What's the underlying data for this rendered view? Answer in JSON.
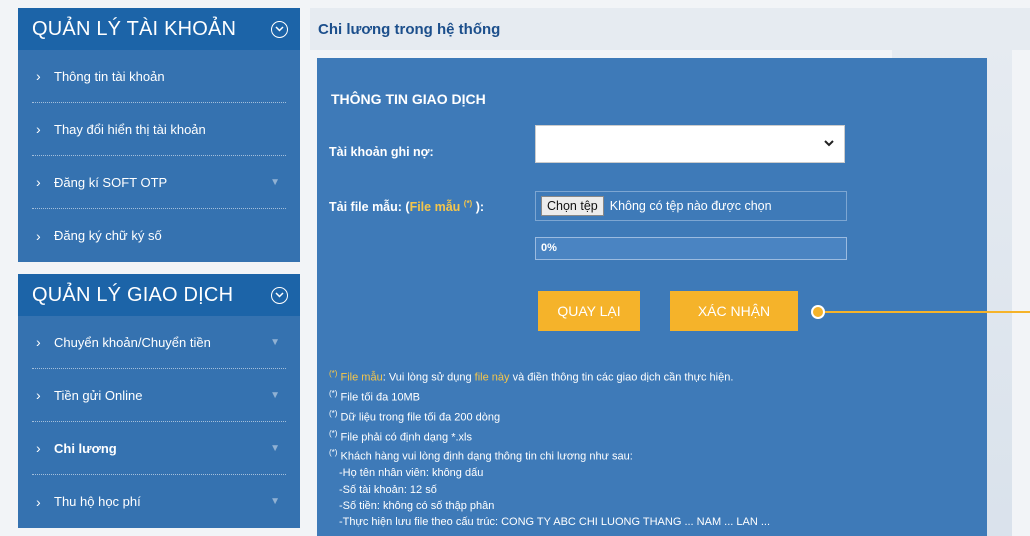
{
  "sidebar": {
    "account_section": {
      "title": "QUẢN LÝ TÀI KHOẢN",
      "items": [
        {
          "label": "Thông tin tài khoản"
        },
        {
          "label": "Thay đổi hiển thị tài khoản"
        },
        {
          "label": "Đăng kí SOFT OTP"
        },
        {
          "label": "Đăng ký chữ ký số"
        }
      ]
    },
    "transaction_section": {
      "title": "QUẢN LÝ GIAO DỊCH",
      "items": [
        {
          "label": "Chuyển khoản/Chuyển tiền"
        },
        {
          "label": "Tiền gửi Online"
        },
        {
          "label": "Chi lương"
        },
        {
          "label": "Thu hộ học phí"
        }
      ]
    }
  },
  "main": {
    "title": "Chi lương trong hệ thống",
    "panel_title": "THÔNG TIN GIAO DỊCH",
    "debit_label": "Tài khoản ghi nợ:",
    "debit_value": "",
    "file_label_prefix": "Tải file mẫu: (",
    "file_label_link": "File mẫu",
    "file_label_mark": "(*)",
    "file_label_suffix": " ):",
    "file_button": "Chọn tệp",
    "file_status": "Không có tệp nào được chọn",
    "progress_text": "0%",
    "progress_value": 0,
    "back_button": "QUAY LẠI",
    "confirm_button": "XÁC NHẬN"
  },
  "notes": {
    "mark": "(*)",
    "line1_link1": "File mẫu",
    "line1_mid": ": Vui lòng sử dụng ",
    "line1_link2": "file này",
    "line1_end": " và điền thông tin các giao dịch cần thực hiện.",
    "line2": " File tối đa 10MB",
    "line3": " Dữ liệu trong file tối đa 200 dòng",
    "line4": " File phải có định dạng *.xls",
    "line5": " Khách hàng vui lòng định dạng thông tin chi lương như sau:",
    "sub1": "-Họ tên nhân viên: không dấu",
    "sub2": "-Số tài khoản: 12 số",
    "sub3": "-Số tiền: không có số thập phân",
    "sub4": "-Thực hiện lưu file theo cấu trúc: CONG TY ABC CHI LUONG THANG ... NAM ... LAN ..."
  },
  "colors": {
    "sidebar_header": "#1c64a8",
    "sidebar_menu": "#3572b0",
    "panel": "#3e7ab8",
    "accent": "#f5b32a",
    "link_yellow": "#f6c64a",
    "title_text": "#1c4f8c"
  },
  "icons": {
    "section_toggle": "circle-chevron-down-icon",
    "menu_arrow": "chevron-right-icon",
    "submenu": "chevron-down-icon",
    "select": "chevron-down-icon"
  }
}
